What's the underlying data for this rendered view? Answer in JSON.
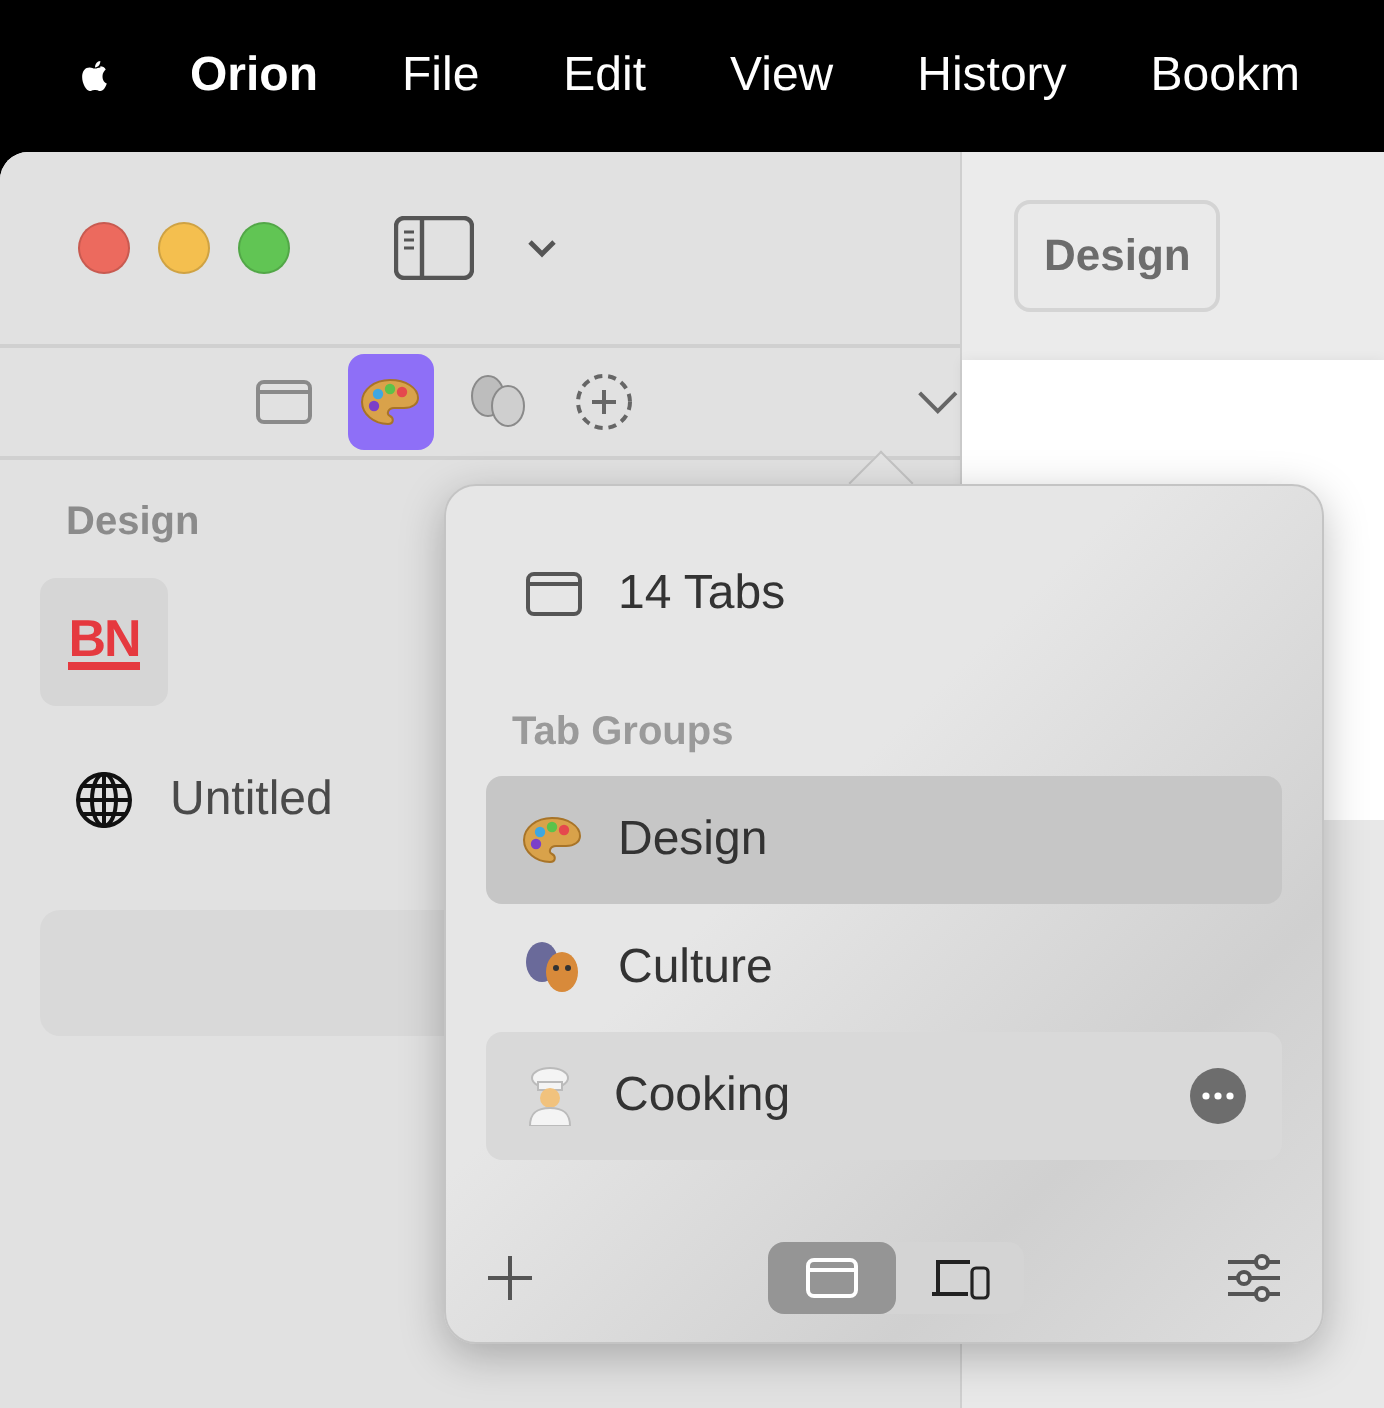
{
  "menu_bar": {
    "items": [
      {
        "label": "Orion",
        "kind": "app"
      },
      {
        "label": "File",
        "kind": "menu"
      },
      {
        "label": "Edit",
        "kind": "menu"
      },
      {
        "label": "View",
        "kind": "menu"
      },
      {
        "label": "History",
        "kind": "menu"
      },
      {
        "label": "Bookm",
        "kind": "menu"
      }
    ]
  },
  "toolbar": {
    "group_button": "Design"
  },
  "sidebar": {
    "group_switcher": [
      {
        "kind": "tabs",
        "selected": false
      },
      {
        "kind": "palette",
        "selected": true
      },
      {
        "kind": "masks",
        "selected": false
      },
      {
        "kind": "add",
        "selected": false
      }
    ],
    "group_title": "Design",
    "pinned": [
      {
        "favicon": "BN"
      }
    ],
    "tabs": [
      {
        "title": "Untitled"
      }
    ]
  },
  "popup": {
    "all_tabs": "14 Tabs",
    "section_title": "Tab Groups",
    "groups": [
      {
        "name": "Design",
        "kind": "palette",
        "selected": true,
        "hovered": false
      },
      {
        "name": "Culture",
        "kind": "masks",
        "selected": false,
        "hovered": false
      },
      {
        "name": "Cooking",
        "kind": "cook",
        "selected": false,
        "hovered": true
      }
    ],
    "view_modes": [
      {
        "kind": "window",
        "selected": true
      },
      {
        "kind": "devices",
        "selected": false
      }
    ]
  }
}
